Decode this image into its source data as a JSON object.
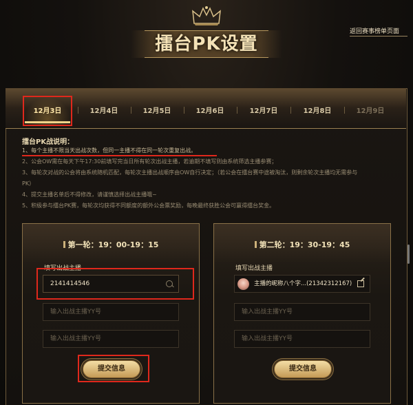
{
  "header": {
    "title": "擂台PK设置",
    "back_link": "返回赛事榜单页面"
  },
  "tabs": [
    "12月3日",
    "12月4日",
    "12月5日",
    "12月6日",
    "12月7日",
    "12月8日",
    "12月9日"
  ],
  "selected_tab": "12月3日",
  "rules": {
    "title": "擂台PK战说明：",
    "items": [
      "1、每个主播不限当天出战次数，但同一主播不得在同一轮次重复出战。",
      "2、公会OW需在每天下午17:30前填写完当日所有轮次出战主播，若逾期不填写则由系统筛选主播参赛；",
      "3、每轮次对战的公会将由系统随机匹配，每轮次主播出战顺序由OW自行决定；（若公会在擂台赛中途被淘汰，则剩余轮次主播均无需参与",
      "PK）",
      "4、提交主播名单后不得修改，请谨慎选择出战主播哦~",
      "5、积极参与擂台PK赛，每轮次均获得不同额度的额外公会票奖励，每晚最终获胜公会可赢得擂台奖金。"
    ]
  },
  "rounds": [
    {
      "title": "第一轮：19：00-19：15",
      "field_label": "填写出战主播",
      "first_input_value": "2141414546",
      "placeholder1": "输入出战主播YY号",
      "placeholder2": "输入出战主播YY号",
      "submit_label": "提交信息"
    },
    {
      "title": "第二轮：19：30-19：45",
      "field_label": "填写出战主播",
      "streamer_chip": "主播的昵称八个字...(21342312167)",
      "placeholder1": "输入出战主播YY号",
      "placeholder2": "输入出战主播YY号",
      "submit_label": "提交信息"
    }
  ],
  "colors": {
    "accent": "#f2d48a",
    "highlight_box": "#e0281c",
    "text_gold": "#e7d7b3"
  },
  "icons": [
    "crown-icon",
    "search-icon",
    "edit-icon"
  ]
}
